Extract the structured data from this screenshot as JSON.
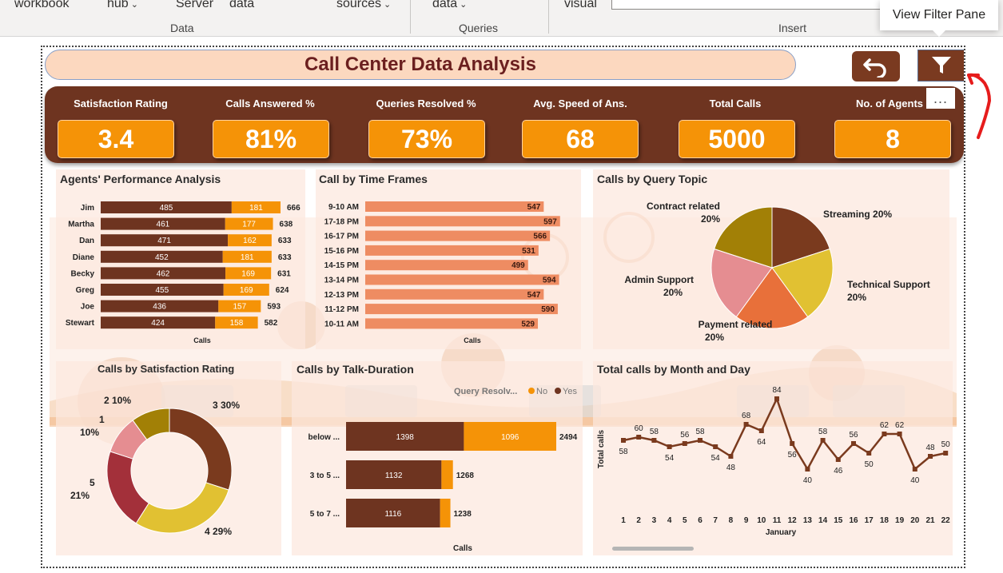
{
  "ribbon": {
    "buttons": [
      {
        "label": "workbook",
        "chevron": false
      },
      {
        "label": "hub",
        "chevron": true
      },
      {
        "label": "Server",
        "chevron": false
      },
      {
        "label": "data",
        "chevron": false
      },
      {
        "label": "sources",
        "chevron": true
      },
      {
        "label": "data",
        "chevron": true
      },
      {
        "label": "visual",
        "chevron": false
      }
    ],
    "groups": [
      "Data",
      "Queries",
      "Insert"
    ]
  },
  "tooltip": "View Filter Pane",
  "title": "Call Center Data Analysis",
  "more_label": "...",
  "kpis": [
    {
      "label": "Satisfaction Rating",
      "value": "3.4"
    },
    {
      "label": "Calls Answered %",
      "value": "81%"
    },
    {
      "label": "Queries Resolved %",
      "value": "73%"
    },
    {
      "label": "Avg. Speed of Ans.",
      "value": "68"
    },
    {
      "label": "Total Calls",
      "value": "5000"
    },
    {
      "label": "No. of Agents",
      "value": "8"
    }
  ],
  "colors": {
    "brown": "#6e3420",
    "orange": "#f59307",
    "salmon": "#ee8c62",
    "title_text": "#6b1f1f"
  },
  "chart_data": [
    {
      "type": "bar",
      "title": "Agents' Performance Analysis",
      "stacked": true,
      "orientation": "horizontal",
      "categories": [
        "Jim",
        "Martha",
        "Dan",
        "Diane",
        "Becky",
        "Greg",
        "Joe",
        "Stewart"
      ],
      "series": [
        {
          "values": [
            485,
            461,
            471,
            452,
            462,
            455,
            436,
            424
          ],
          "color": "#6e3420"
        },
        {
          "values": [
            181,
            177,
            162,
            181,
            169,
            169,
            157,
            158
          ],
          "color": "#f59307"
        }
      ],
      "totals": [
        666,
        638,
        633,
        633,
        631,
        624,
        593,
        582
      ],
      "xlabel": "Calls"
    },
    {
      "type": "bar",
      "title": "Call by Time Frames",
      "orientation": "horizontal",
      "categories": [
        "9-10 AM",
        "17-18 PM",
        "16-17 PM",
        "15-16 PM",
        "14-15 PM",
        "13-14 PM",
        "12-13 PM",
        "11-12 PM",
        "10-11 AM"
      ],
      "values": [
        547,
        597,
        566,
        531,
        499,
        594,
        547,
        590,
        529
      ],
      "xlabel": "Calls",
      "color": "#ee8c62"
    },
    {
      "type": "pie",
      "title": "Calls by Query Topic",
      "slices": [
        {
          "label": "Streaming",
          "value": 20,
          "color": "#7a3a1e",
          "text": "Streaming 20%"
        },
        {
          "label": "Technical Support",
          "value": 20,
          "color": "#e1c132",
          "text": "Technical Support 20%"
        },
        {
          "label": "Payment related",
          "value": 20,
          "color": "#e8703a",
          "text": "Payment related 20%"
        },
        {
          "label": "Admin Support",
          "value": 20,
          "color": "#e58d91",
          "text": "Admin Support 20%"
        },
        {
          "label": "Contract related",
          "value": 20,
          "color": "#a28006",
          "text": "Contract related 20%"
        }
      ]
    },
    {
      "type": "pie",
      "donut": true,
      "title": "Calls by Satisfaction Rating",
      "slices": [
        {
          "label": "3",
          "value": 30,
          "color": "#7a3a1e",
          "text": "3 30%"
        },
        {
          "label": "4",
          "value": 29,
          "color": "#e1c132",
          "text": "4 29%"
        },
        {
          "label": "5",
          "value": 21,
          "color": "#a3303a",
          "text": "5 21%"
        },
        {
          "label": "1",
          "value": 10,
          "color": "#e58d91",
          "text": "1 10%"
        },
        {
          "label": "2",
          "value": 10,
          "color": "#a28006",
          "text": "2 10%"
        }
      ]
    },
    {
      "type": "bar",
      "title": "Calls by Talk-Duration",
      "stacked": true,
      "orientation": "horizontal",
      "legend_title": "Query Resolv...",
      "categories": [
        "below ...",
        "3 to 5 ...",
        "5 to 7 ..."
      ],
      "series": [
        {
          "name": "Yes",
          "values": [
            1398,
            1132,
            1116
          ],
          "color": "#6e3420"
        },
        {
          "name": "No",
          "values": [
            1096,
            136,
            122
          ],
          "color": "#f59307"
        }
      ],
      "totals": [
        2494,
        1268,
        1238
      ],
      "xlabel": "Calls"
    },
    {
      "type": "line",
      "title": "Total calls by Month and Day",
      "x": [
        1,
        2,
        3,
        4,
        5,
        6,
        7,
        8,
        9,
        10,
        11,
        12,
        13,
        14,
        15,
        16,
        17,
        18,
        19,
        20,
        21,
        22
      ],
      "values": [
        58,
        60,
        58,
        54,
        56,
        58,
        54,
        48,
        68,
        64,
        84,
        56,
        40,
        58,
        46,
        56,
        50,
        62,
        62,
        40,
        48,
        50
      ],
      "xlabel": "January",
      "ylabel": "Total calls",
      "color": "#7a3a1e"
    }
  ]
}
